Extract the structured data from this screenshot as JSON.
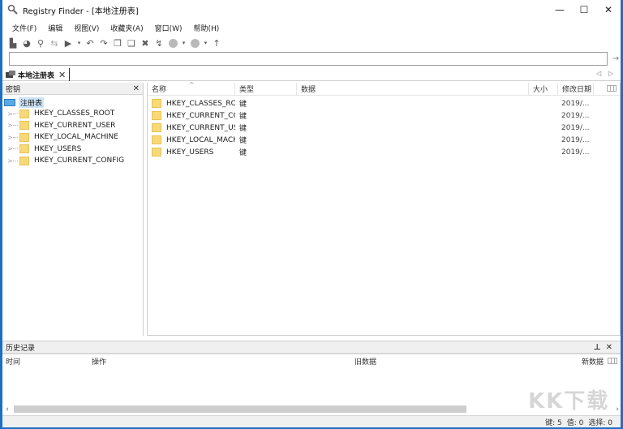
{
  "window": {
    "title": "Registry Finder - [本地注册表]",
    "controls": {
      "minimize": "—",
      "maximize": "☐",
      "close": "✕"
    }
  },
  "menu": [
    "文件(F)",
    "编辑",
    "视图(V)",
    "收藏夹(A)",
    "窗口(W)",
    "帮助(H)"
  ],
  "toolbar": [
    {
      "name": "local-registry-icon",
      "glyph": "▙"
    },
    {
      "name": "remote-registry-icon",
      "glyph": "◕"
    },
    {
      "name": "find-icon",
      "glyph": "⚲"
    },
    {
      "name": "replace-icon",
      "glyph": "⇆"
    },
    {
      "name": "export-icon",
      "glyph": "▶"
    },
    {
      "name": "export-dropdown-icon",
      "glyph": "▾"
    },
    {
      "name": "undo-icon",
      "glyph": "↶"
    },
    {
      "name": "redo-icon",
      "glyph": "↷"
    },
    {
      "name": "copy-icon",
      "glyph": "❐"
    },
    {
      "name": "paste-icon",
      "glyph": "❏"
    },
    {
      "name": "delete-icon",
      "glyph": "✖"
    },
    {
      "name": "refresh-icon",
      "glyph": "↯"
    },
    {
      "name": "back-icon",
      "glyph": "●"
    },
    {
      "name": "back-dropdown-icon",
      "glyph": "▾"
    },
    {
      "name": "forward-icon",
      "glyph": "●"
    },
    {
      "name": "forward-dropdown-icon",
      "glyph": "▾"
    },
    {
      "name": "up-icon",
      "glyph": "↑"
    }
  ],
  "address": {
    "value": "",
    "go_glyph": "→"
  },
  "tabs": [
    {
      "label": "本地注册表",
      "close_glyph": "✕"
    }
  ],
  "tab_nav": "◁ ▷",
  "left_pane": {
    "title": "密钥",
    "close_glyph": "✕",
    "root": "注册表",
    "nodes": [
      "HKEY_CLASSES_ROOT",
      "HKEY_CURRENT_USER",
      "HKEY_LOCAL_MACHINE",
      "HKEY_USERS",
      "HKEY_CURRENT_CONFIG"
    ]
  },
  "list": {
    "sort_glyph": "^",
    "columns": [
      "名称",
      "类型",
      "数据",
      "大小",
      "修改日期"
    ],
    "rows": [
      {
        "name": "HKEY_CLASSES_ROOT",
        "type": "键",
        "data": "",
        "size": "",
        "modified": "2019/..."
      },
      {
        "name": "HKEY_CURRENT_CO...",
        "type": "键",
        "data": "",
        "size": "",
        "modified": "2019/..."
      },
      {
        "name": "HKEY_CURRENT_US...",
        "type": "键",
        "data": "",
        "size": "",
        "modified": "2019/..."
      },
      {
        "name": "HKEY_LOCAL_MACH...",
        "type": "键",
        "data": "",
        "size": "",
        "modified": "2019/..."
      },
      {
        "name": "HKEY_USERS",
        "type": "键",
        "data": "",
        "size": "",
        "modified": "2019/..."
      }
    ]
  },
  "history": {
    "title": "历史记录",
    "pin_glyph": "⊥",
    "close_glyph": "✕",
    "columns": [
      "时间",
      "操作",
      "旧数据",
      "新数据"
    ]
  },
  "scrollbar": {
    "left_glyph": "‹",
    "right_glyph": "›"
  },
  "status": {
    "keys": "键: 5",
    "values": "值: 0",
    "selected": "选择: 0"
  },
  "watermark": "KK下载"
}
